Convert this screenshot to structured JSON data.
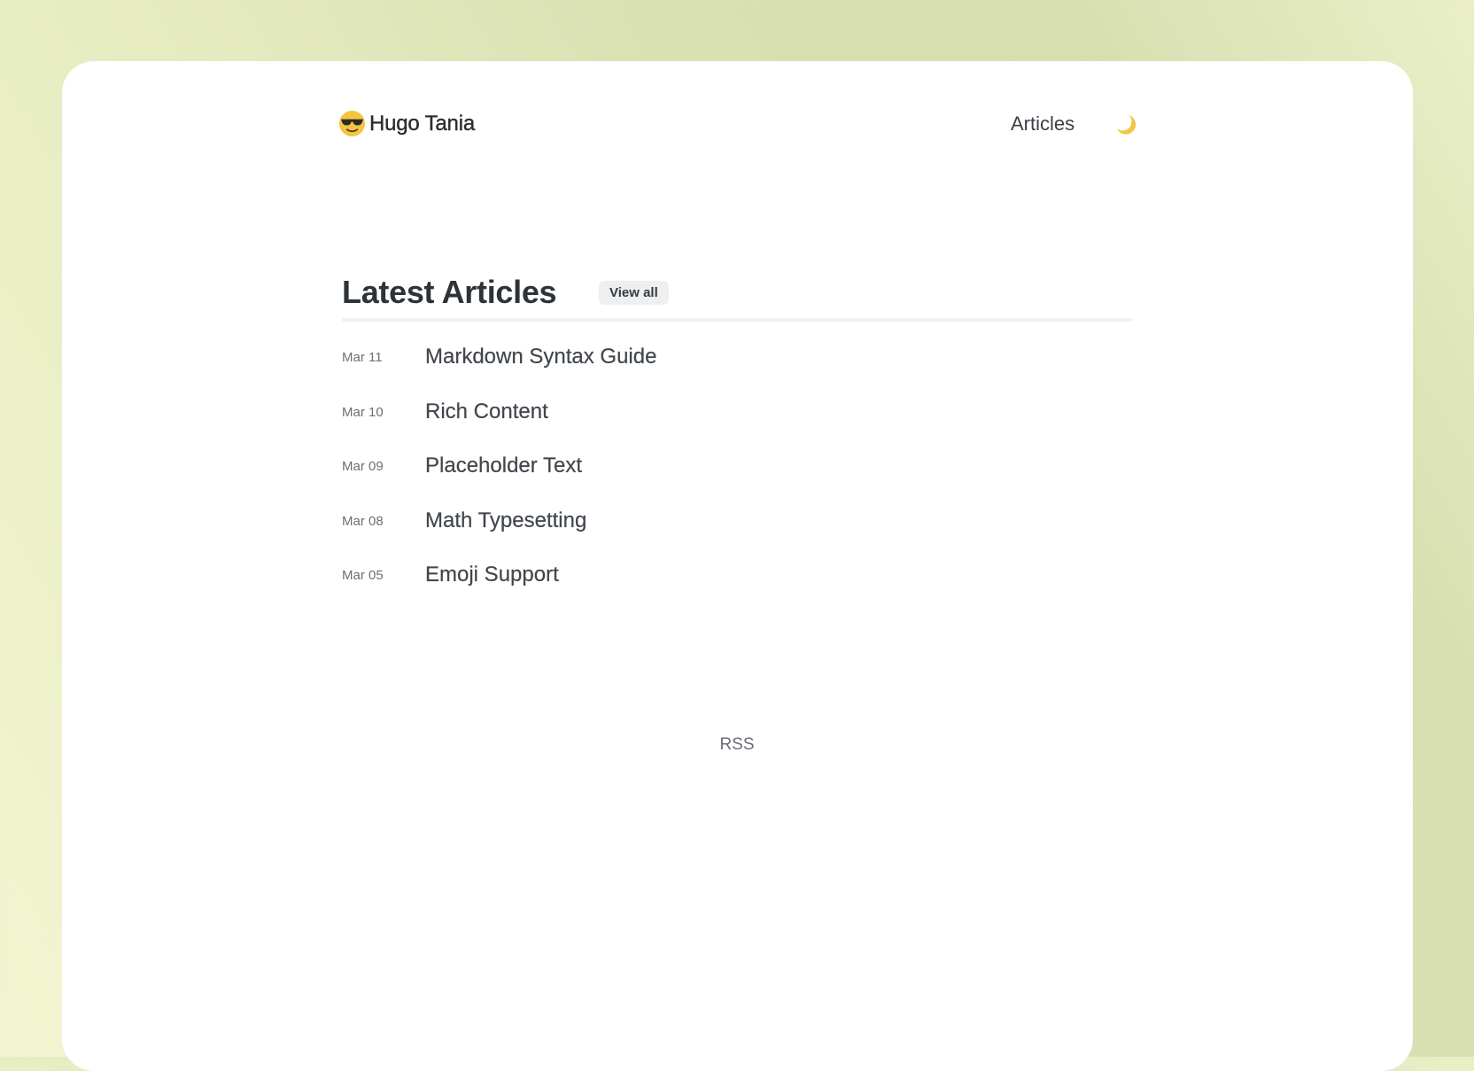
{
  "header": {
    "brand_name": "Hugo Tania",
    "brand_logo_icon": "sunglasses-emoji-icon",
    "nav": [
      {
        "label": "Articles"
      }
    ],
    "theme_toggle_icon": "moon-icon"
  },
  "main": {
    "section_title": "Latest Articles",
    "view_all_label": "View all",
    "articles": [
      {
        "date": "Mar 11",
        "title": "Markdown Syntax Guide"
      },
      {
        "date": "Mar 10",
        "title": "Rich Content"
      },
      {
        "date": "Mar 09",
        "title": "Placeholder Text"
      },
      {
        "date": "Mar 08",
        "title": "Math Typesetting"
      },
      {
        "date": "Mar 05",
        "title": "Emoji Support"
      }
    ]
  },
  "footer": {
    "rss_label": "RSS"
  },
  "colors": {
    "page_background": "#d9e1b3",
    "card_background": "#ffffff",
    "text_primary": "#2e3338",
    "moon_yellow": "#f5c542"
  }
}
